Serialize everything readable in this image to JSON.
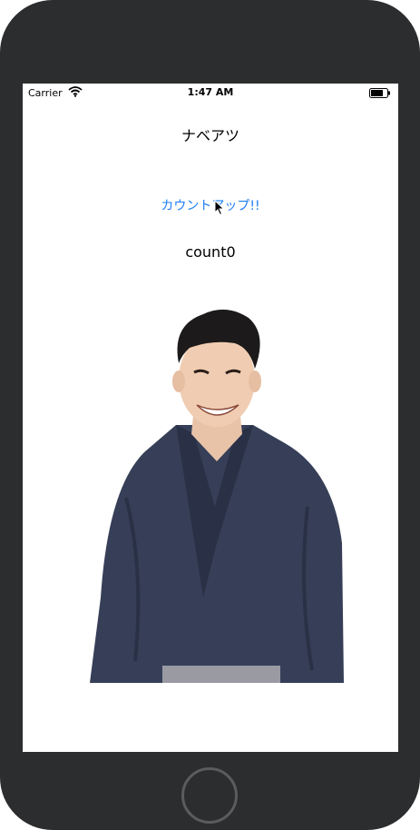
{
  "status_bar": {
    "carrier": "Carrier",
    "time": "1:47 AM"
  },
  "main": {
    "title": "ナベアツ",
    "count_button_label": "カウントアップ!!",
    "count_label": "count0"
  },
  "colors": {
    "accent": "#1d7ef4",
    "device_frame": "#2b2d2e",
    "kimono": "#363f57"
  },
  "icons": [
    "wifi-icon",
    "battery-icon",
    "cursor-icon"
  ]
}
